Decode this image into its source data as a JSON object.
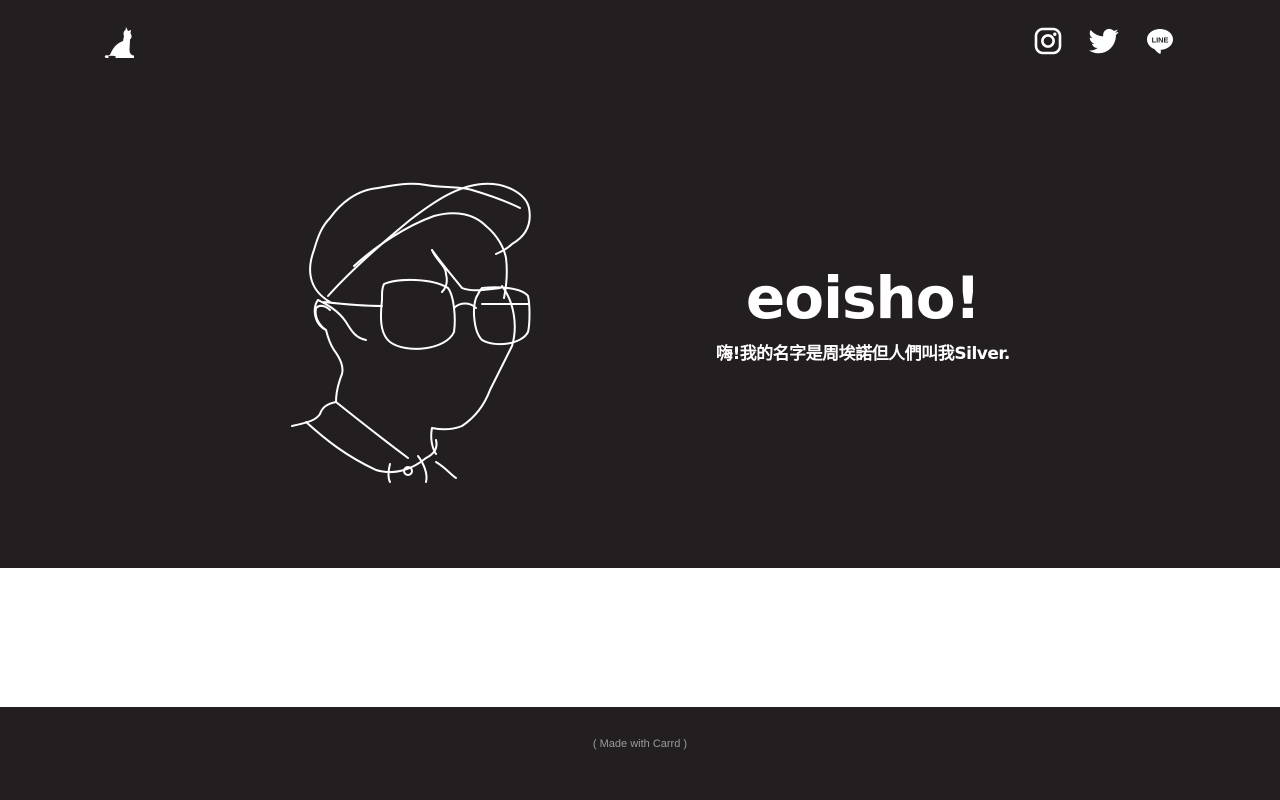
{
  "header": {
    "logo_icon": "cat-icon",
    "social_links": [
      {
        "name": "Instagram",
        "icon": "instagram-icon"
      },
      {
        "name": "Twitter",
        "icon": "twitter-icon"
      },
      {
        "name": "LINE",
        "icon": "line-icon",
        "badge_text": "LINE"
      }
    ]
  },
  "hero": {
    "illustration": "line-art-portrait-cap-glasses",
    "title": "eoisho!",
    "tagline": "嗨!我的名字是周埃諾但人們叫我Silver."
  },
  "footer": {
    "credit": "( Made with Carrd )"
  },
  "colors": {
    "dark_background": "#231f20",
    "text": "#ffffff",
    "middle_band": "#ffffff",
    "credit_text": "#9a9a9a"
  }
}
